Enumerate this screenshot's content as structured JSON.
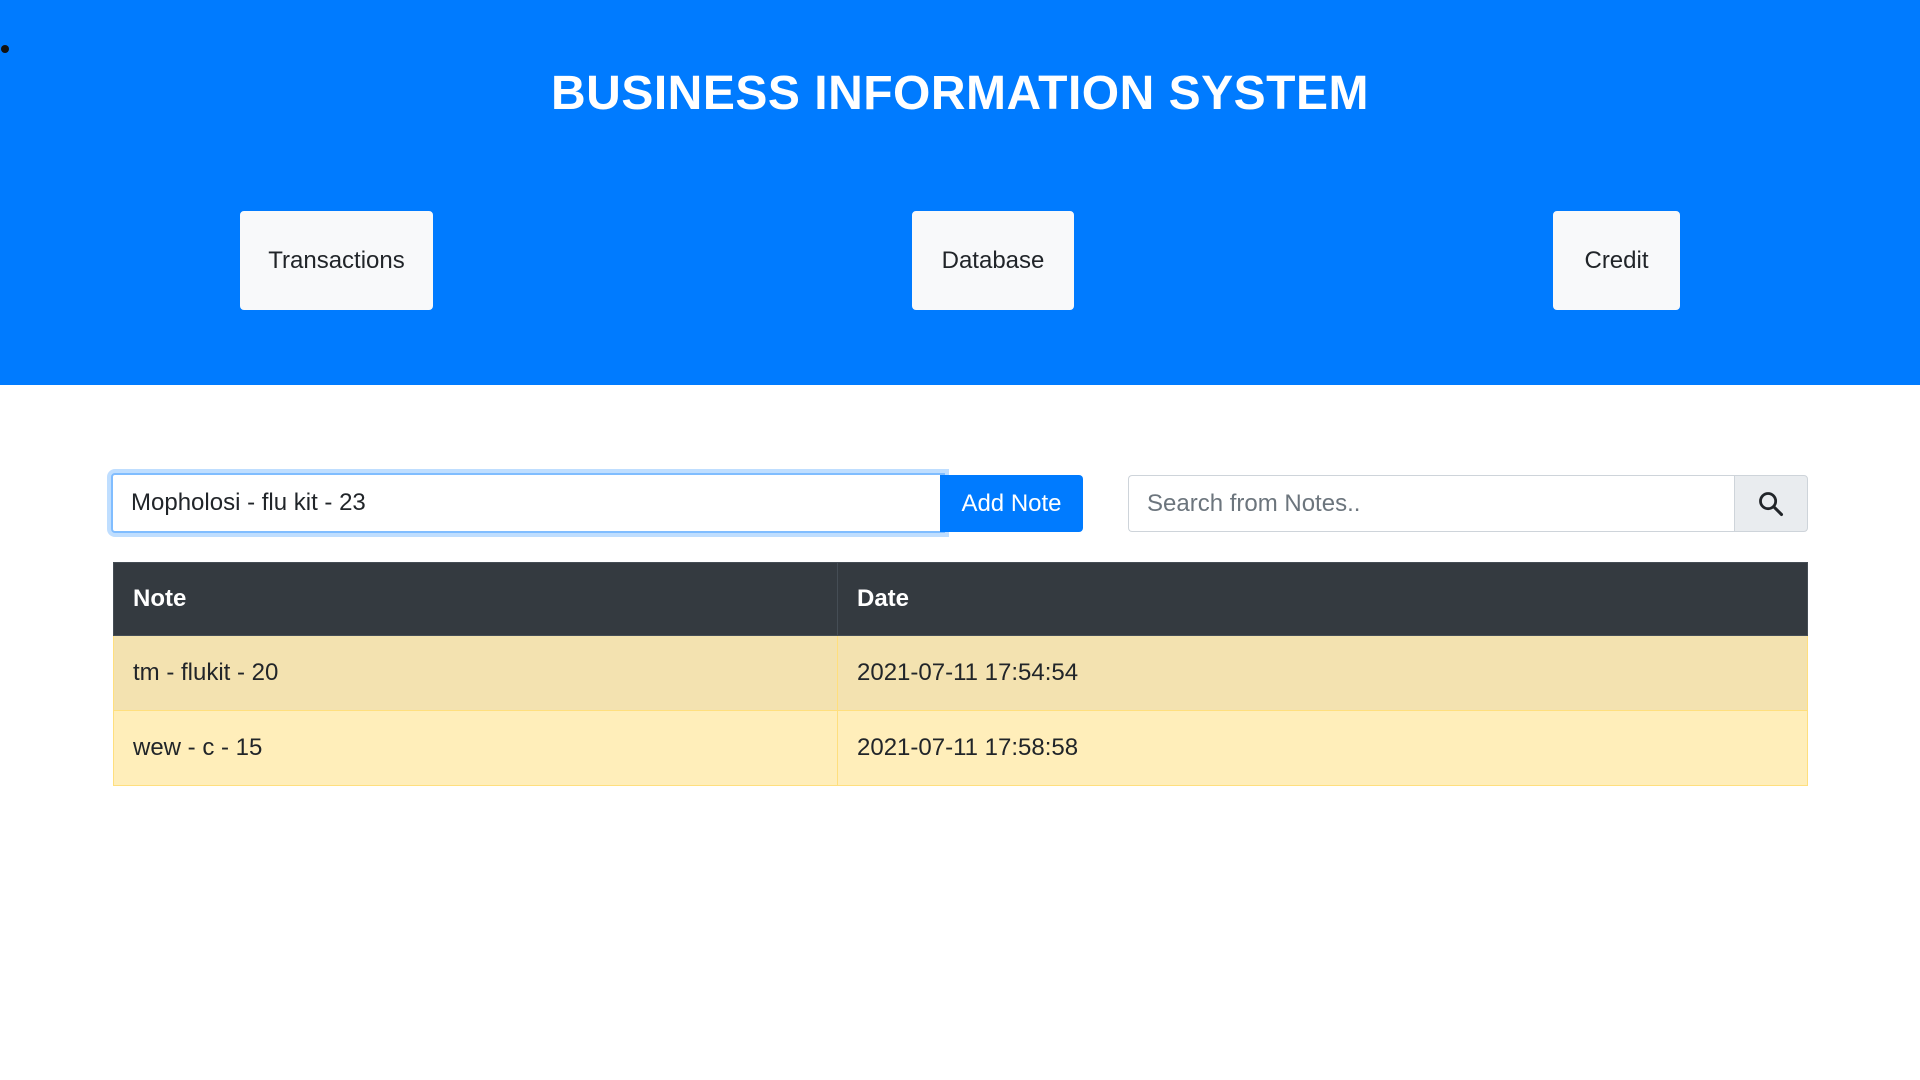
{
  "header": {
    "title": "BUSINESS INFORMATION SYSTEM",
    "nav": {
      "transactions": "Transactions",
      "database": "Database",
      "credit": "Credit"
    },
    "background_color": "#007bff"
  },
  "note_form": {
    "input_value": "Mopholosi - flu kit - 23",
    "add_label": "Add Note"
  },
  "search": {
    "placeholder": "Search from Notes..",
    "icon": "search-icon"
  },
  "table": {
    "headers": {
      "note": "Note",
      "date": "Date"
    },
    "rows": [
      {
        "note": "tm - flukit - 20",
        "date": "2021-07-11 17:54:54"
      },
      {
        "note": "wew - c - 15",
        "date": "2021-07-11 17:58:58"
      }
    ]
  }
}
